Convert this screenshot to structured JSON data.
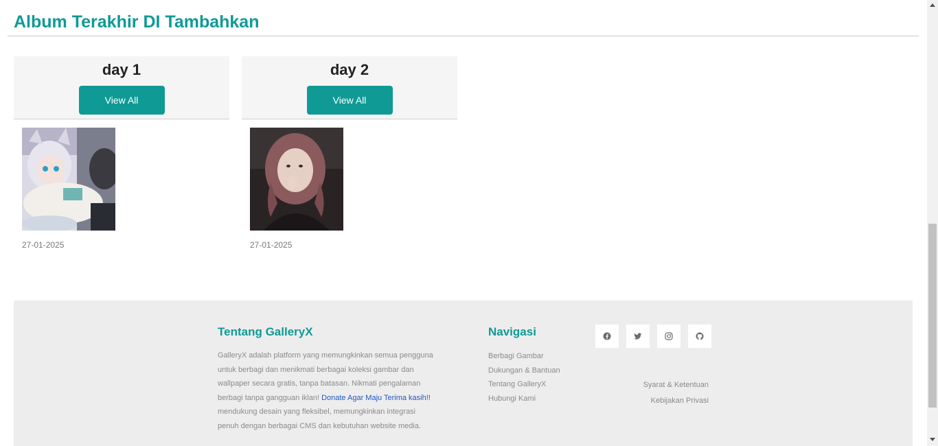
{
  "section": {
    "title": "Album Terakhir DI Tambahkan"
  },
  "albums": [
    {
      "name": "day 1",
      "button": "View All",
      "date": "27-01-2025"
    },
    {
      "name": "day 2",
      "button": "View All",
      "date": "27-01-2025"
    }
  ],
  "footer": {
    "about": {
      "title": "Tentang GalleryX",
      "text_1": "GalleryX adalah platform yang memungkinkan semua pengguna untuk berbagi dan menikmati berbagai koleksi gambar dan wallpaper secara gratis, tanpa batasan. Nikmati pengalaman berbagi tanpa gangguan iklan! ",
      "link": "Donate Agar Maju Terima kasih!!",
      "text_2": " mendukung desain yang fleksibel, memungkinkan integrasi penuh dengan berbagai CMS dan kebutuhan website media."
    },
    "nav": {
      "title": "Navigasi",
      "items": [
        "Berbagi Gambar",
        "Dukungan & Bantuan",
        "Tentang GalleryX",
        "Hubungi Kami"
      ]
    },
    "social_icons": [
      "facebook-icon",
      "twitter-icon",
      "instagram-icon",
      "github-icon"
    ],
    "legal": [
      "Syarat & Ketentuan",
      "Kebijakan Privasi"
    ]
  },
  "colors": {
    "accent": "#0f9a96",
    "footer_bg": "#ededed",
    "link": "#2257c4"
  }
}
